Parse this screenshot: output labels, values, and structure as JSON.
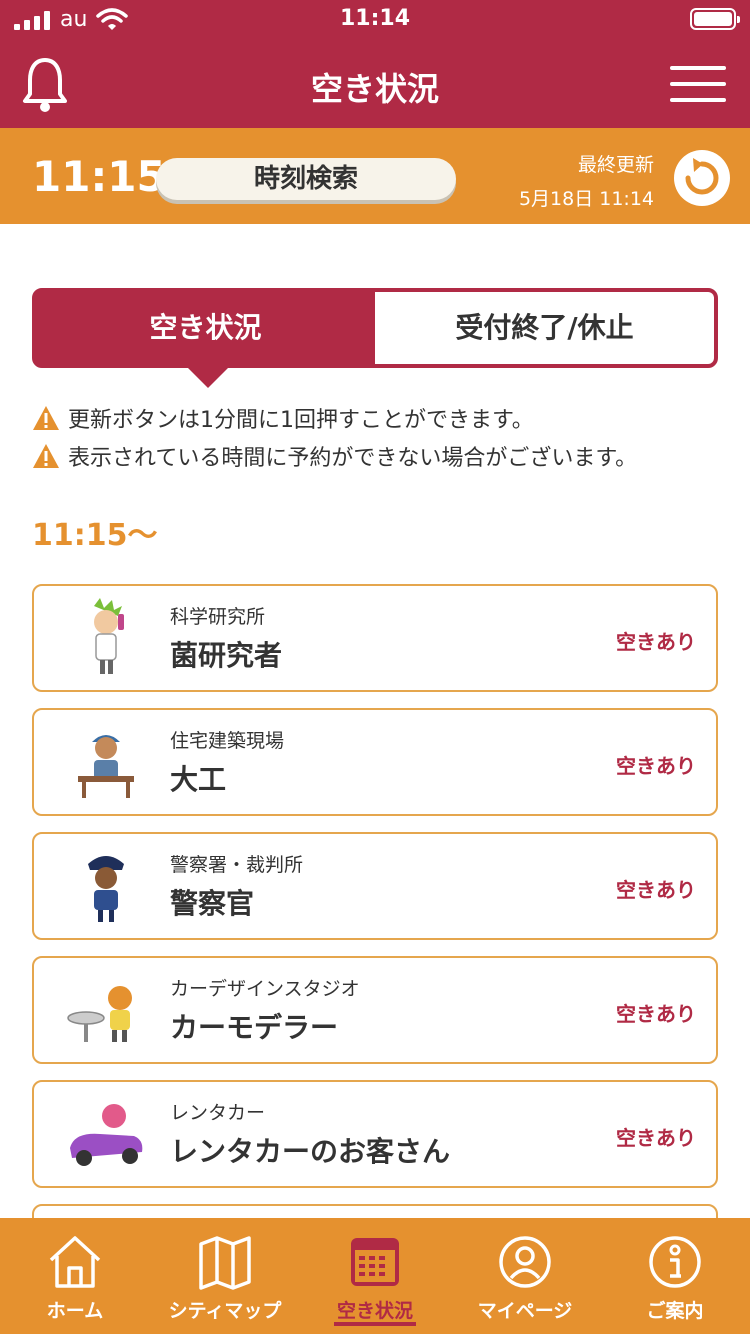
{
  "status_bar": {
    "carrier": "au",
    "time": "11:14"
  },
  "header": {
    "title": "空き状況",
    "left_icon": "bell-icon",
    "right_icon": "hamburger-menu-icon"
  },
  "time_bar": {
    "current_time": "11:15",
    "search_label": "時刻検索",
    "last_updated_label": "最終更新",
    "last_updated_value": "5月18日 11:14",
    "refresh_icon": "refresh-icon"
  },
  "tabs": [
    {
      "label": "空き状況",
      "active": true
    },
    {
      "label": "受付終了/休止",
      "active": false
    }
  ],
  "notices": [
    "更新ボタンは1分間に1回押すことができます。",
    "表示されている時間に予約ができない場合がございます。"
  ],
  "slot_time": "11:15〜",
  "cards": [
    {
      "location": "科学研究所",
      "job": "菌研究者",
      "availability": "空きあり"
    },
    {
      "location": "住宅建築現場",
      "job": "大工",
      "availability": "空きあり"
    },
    {
      "location": "警察署・裁判所",
      "job": "警察官",
      "availability": "空きあり"
    },
    {
      "location": "カーデザインスタジオ",
      "job": "カーモデラー",
      "availability": "空きあり"
    },
    {
      "location": "レンタカー",
      "job": "レンタカーのお客さん",
      "availability": "空きあり"
    }
  ],
  "bottom_nav": [
    {
      "label": "ホーム",
      "icon": "home-icon",
      "active": false
    },
    {
      "label": "シティマップ",
      "icon": "map-icon",
      "active": false
    },
    {
      "label": "空き状況",
      "icon": "calendar-icon",
      "active": true
    },
    {
      "label": "マイページ",
      "icon": "user-icon",
      "active": false
    },
    {
      "label": "ご案内",
      "icon": "info-icon",
      "active": false
    }
  ],
  "colors": {
    "primary": "#b02a45",
    "accent": "#e5912f"
  }
}
